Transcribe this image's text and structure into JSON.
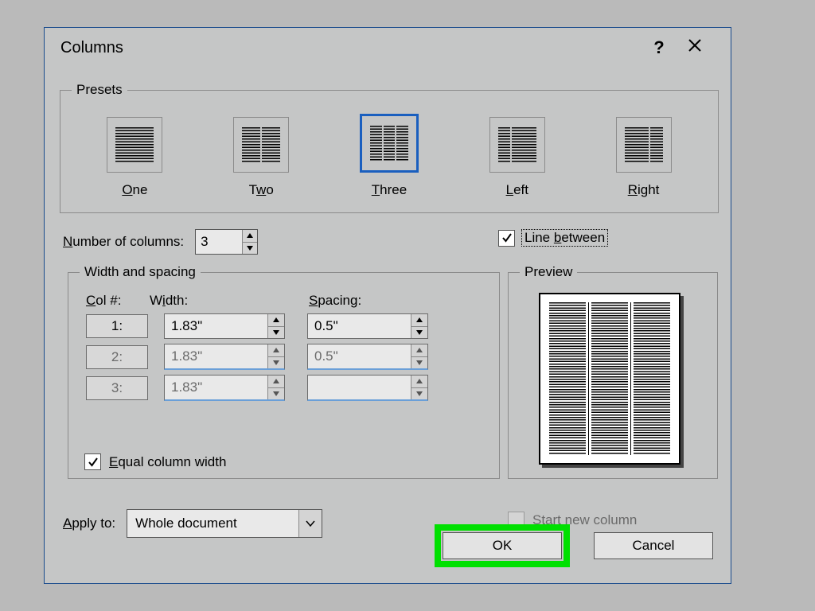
{
  "dialog": {
    "title": "Columns",
    "help_glyph": "?",
    "close_glyph": "X"
  },
  "presets": {
    "legend": "Presets",
    "items": [
      {
        "label": "One",
        "label_html": "<span class='u'>O</span>ne"
      },
      {
        "label": "Two",
        "label_html": "T<span class='u'>w</span>o"
      },
      {
        "label": "Three",
        "label_html": "<span class='u'>T</span>hree",
        "selected": true
      },
      {
        "label": "Left",
        "label_html": "<span class='u'>L</span>eft"
      },
      {
        "label": "Right",
        "label_html": "<span class='u'>R</span>ight"
      }
    ]
  },
  "num_columns": {
    "label_html": "<span class='u'>N</span>umber of columns:",
    "value": "3"
  },
  "line_between": {
    "label_html": "Line <span class='u'>b</span>etween",
    "checked": true
  },
  "width_spacing": {
    "legend": "Width and spacing",
    "headers": {
      "col": "<span class='u'>C</span>ol #:",
      "width": "W<span class='u'>i</span>dth:",
      "spacing": "<span class='u'>S</span>pacing:"
    },
    "rows": [
      {
        "num": "1:",
        "width": "1.83\"",
        "spacing": "0.5\"",
        "enabled": true
      },
      {
        "num": "2:",
        "width": "1.83\"",
        "spacing": "0.5\"",
        "enabled": false
      },
      {
        "num": "3:",
        "width": "1.83\"",
        "spacing": "",
        "enabled": false
      }
    ],
    "equal": {
      "label_html": "<span class='u'>E</span>qual column width",
      "checked": true
    }
  },
  "preview": {
    "legend": "Preview"
  },
  "apply_to": {
    "label_html": "<span class='u'>A</span>pply to:",
    "value": "Whole document"
  },
  "start_new": {
    "label": "Start new column",
    "checked": false,
    "enabled": false
  },
  "buttons": {
    "ok": "OK",
    "cancel": "Cancel"
  }
}
